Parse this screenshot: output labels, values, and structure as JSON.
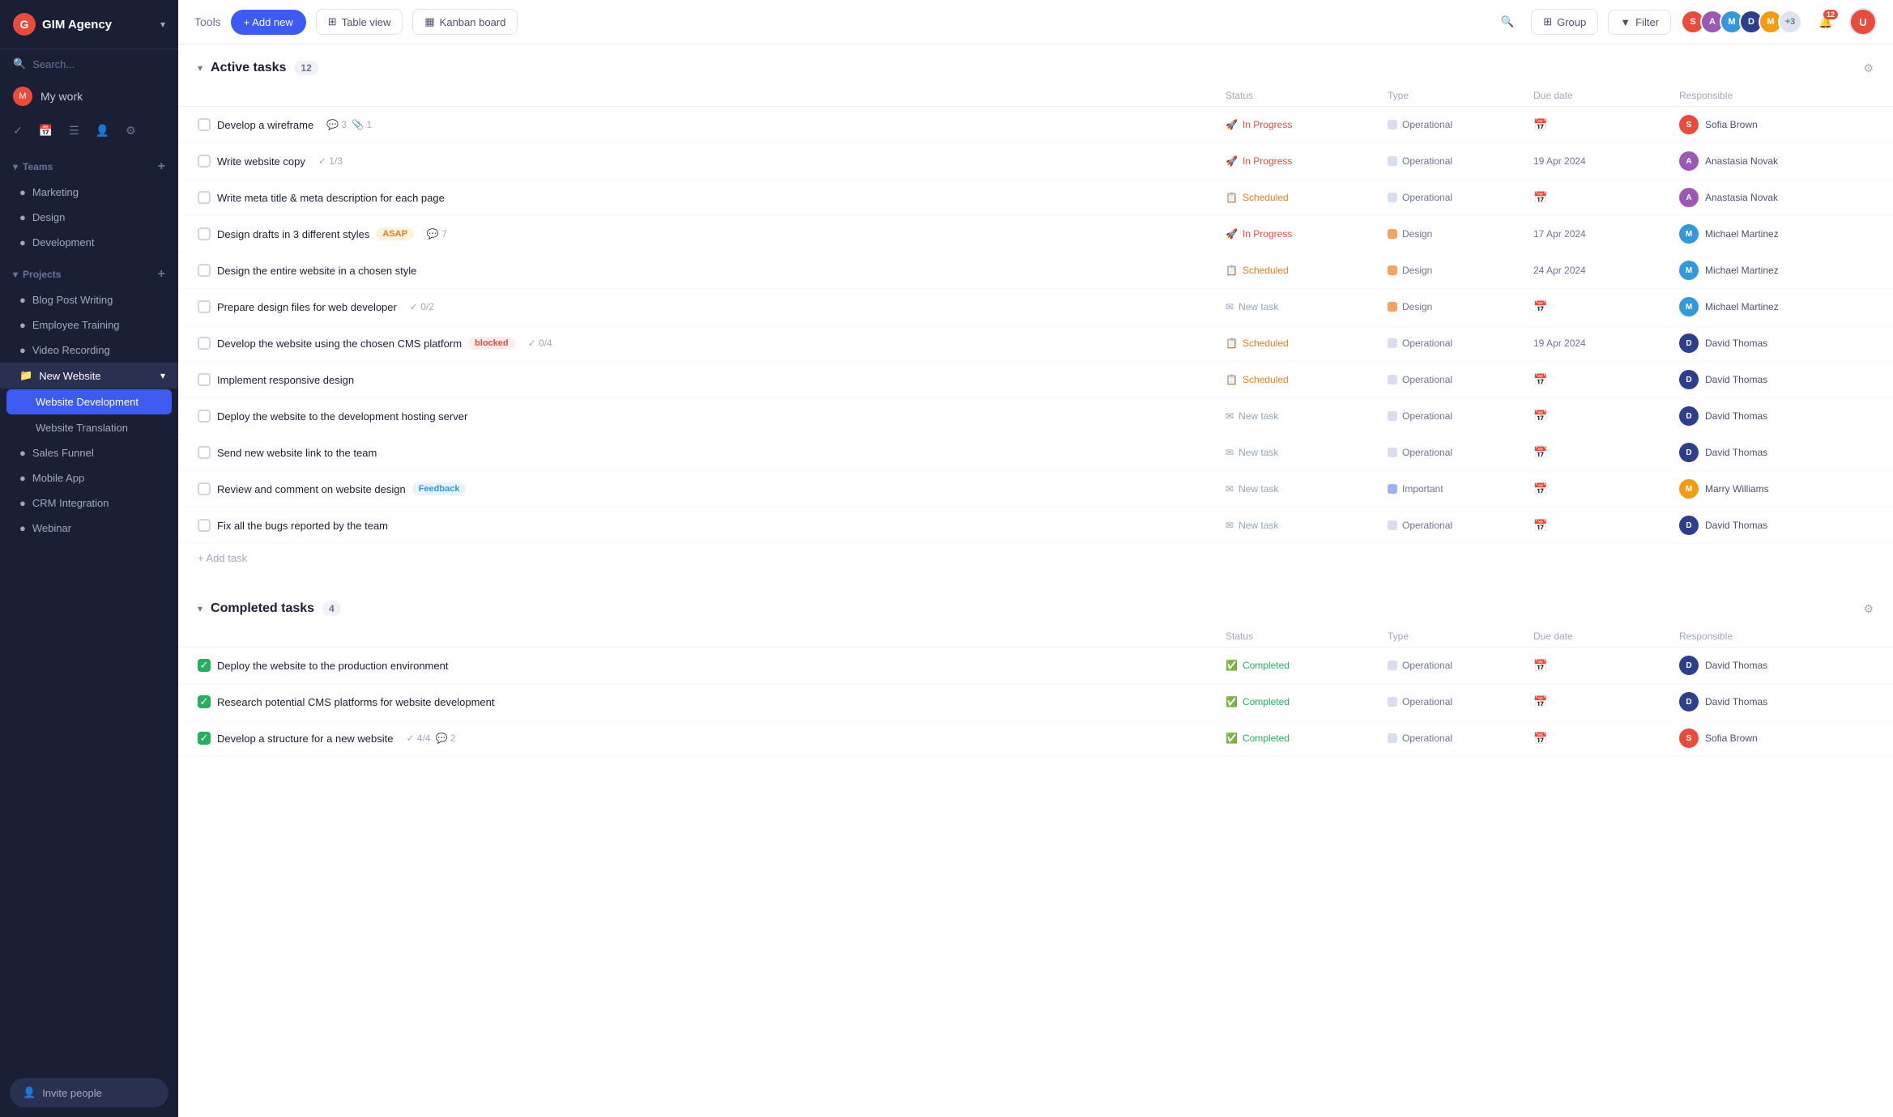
{
  "app": {
    "name": "GIM Agency",
    "chevron": "▾"
  },
  "sidebar": {
    "search_placeholder": "Search...",
    "my_work_label": "My work",
    "teams_label": "Teams",
    "teams": [
      {
        "label": "Marketing"
      },
      {
        "label": "Design"
      },
      {
        "label": "Development"
      }
    ],
    "projects_label": "Projects",
    "projects": [
      {
        "label": "Blog Post Writing",
        "active": false
      },
      {
        "label": "Employee Training",
        "active": false
      },
      {
        "label": "Video Recording",
        "active": false
      },
      {
        "label": "New Website",
        "active": true,
        "has_submenu": true
      },
      {
        "label": "Website Development",
        "active": true,
        "sub": true
      },
      {
        "label": "Website Translation",
        "active": false,
        "sub": true
      },
      {
        "label": "Sales Funnel",
        "active": false
      },
      {
        "label": "Mobile App",
        "active": false
      },
      {
        "label": "CRM Integration",
        "active": false
      },
      {
        "label": "Webinar",
        "active": false
      }
    ],
    "invite_people_label": "Invite people"
  },
  "toolbar": {
    "tools_label": "Tools",
    "add_new_label": "+ Add new",
    "table_view_label": "Table view",
    "kanban_board_label": "Kanban board",
    "group_label": "Group",
    "filter_label": "Filter",
    "avatar_extra_count": "+3",
    "notification_count": "12"
  },
  "active_section": {
    "title": "Active tasks",
    "count": "12",
    "columns": [
      "",
      "Status",
      "Type",
      "Due date",
      "Responsible",
      ""
    ],
    "tasks": [
      {
        "name": "Develop a wireframe",
        "comments": "3",
        "attachments": "1",
        "status": "In Progress",
        "status_type": "in-progress",
        "type": "Operational",
        "type_style": "operational",
        "due_date": "",
        "responsible": "Sofia Brown",
        "responsible_style": "sofia",
        "tags": []
      },
      {
        "name": "Write website copy",
        "progress": "1/3",
        "status": "In Progress",
        "status_type": "in-progress",
        "type": "Operational",
        "type_style": "operational",
        "due_date": "19 Apr 2024",
        "responsible": "Anastasia Novak",
        "responsible_style": "anastasia",
        "tags": []
      },
      {
        "name": "Write meta title & meta description for each page",
        "status": "Scheduled",
        "status_type": "scheduled",
        "type": "Operational",
        "type_style": "operational",
        "due_date": "",
        "responsible": "Anastasia Novak",
        "responsible_style": "anastasia",
        "tags": []
      },
      {
        "name": "Design drafts in 3 different styles",
        "tag": "ASAP",
        "tag_style": "asap",
        "comments": "7",
        "status": "In Progress",
        "status_type": "in-progress",
        "type": "Design",
        "type_style": "design",
        "due_date": "17 Apr 2024",
        "responsible": "Michael Martinez",
        "responsible_style": "michael",
        "tags": [
          "ASAP"
        ]
      },
      {
        "name": "Design the entire website in a chosen style",
        "status": "Scheduled",
        "status_type": "scheduled",
        "type": "Design",
        "type_style": "design",
        "due_date": "24 Apr 2024",
        "responsible": "Michael Martinez",
        "responsible_style": "michael",
        "tags": []
      },
      {
        "name": "Prepare design files for web developer",
        "progress": "0/2",
        "status": "New task",
        "status_type": "new-task",
        "type": "Design",
        "type_style": "design",
        "due_date": "",
        "responsible": "Michael Martinez",
        "responsible_style": "michael",
        "tags": []
      },
      {
        "name": "Develop the website using the chosen CMS platform",
        "tag": "blocked",
        "tag_style": "blocked",
        "progress": "0/4",
        "status": "Scheduled",
        "status_type": "scheduled",
        "type": "Operational",
        "type_style": "operational",
        "due_date": "19 Apr 2024",
        "responsible": "David Thomas",
        "responsible_style": "david",
        "tags": [
          "blocked"
        ]
      },
      {
        "name": "Implement responsive design",
        "status": "Scheduled",
        "status_type": "scheduled",
        "type": "Operational",
        "type_style": "operational",
        "due_date": "",
        "responsible": "David Thomas",
        "responsible_style": "david",
        "tags": []
      },
      {
        "name": "Deploy the website to the development hosting server",
        "status": "New task",
        "status_type": "new-task",
        "type": "Operational",
        "type_style": "operational",
        "due_date": "",
        "responsible": "David Thomas",
        "responsible_style": "david",
        "tags": []
      },
      {
        "name": "Send new website link to the team",
        "status": "New task",
        "status_type": "new-task",
        "type": "Operational",
        "type_style": "operational",
        "due_date": "",
        "responsible": "David Thomas",
        "responsible_style": "david",
        "tags": []
      },
      {
        "name": "Review and comment on website design",
        "tag": "Feedback",
        "tag_style": "feedback",
        "status": "New task",
        "status_type": "new-task",
        "type": "Important",
        "type_style": "important",
        "due_date": "",
        "responsible": "Marry Williams",
        "responsible_style": "marry",
        "tags": [
          "Feedback"
        ]
      },
      {
        "name": "Fix all the bugs reported by the team",
        "status": "New task",
        "status_type": "new-task",
        "type": "Operational",
        "type_style": "operational",
        "due_date": "",
        "responsible": "David Thomas",
        "responsible_style": "david",
        "tags": []
      }
    ],
    "add_task_label": "+ Add task"
  },
  "completed_section": {
    "title": "Completed tasks",
    "count": "4",
    "columns": [
      "",
      "Status",
      "Type",
      "Due date",
      "Responsible",
      ""
    ],
    "tasks": [
      {
        "name": "Deploy the website to the production environment",
        "status": "Completed",
        "status_type": "completed",
        "type": "Operational",
        "type_style": "operational",
        "due_date": "",
        "responsible": "David Thomas",
        "responsible_style": "david"
      },
      {
        "name": "Research potential CMS platforms for website development",
        "status": "Completed",
        "status_type": "completed",
        "type": "Operational",
        "type_style": "operational",
        "due_date": "",
        "responsible": "David Thomas",
        "responsible_style": "david"
      },
      {
        "name": "Develop a structure for a new website",
        "progress": "4/4",
        "comments": "2",
        "status": "Completed",
        "status_type": "completed",
        "type": "Operational",
        "type_style": "operational",
        "due_date": "",
        "responsible": "Sofia Brown",
        "responsible_style": "sofia"
      }
    ]
  }
}
